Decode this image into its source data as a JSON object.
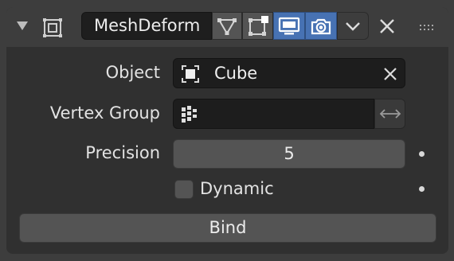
{
  "header": {
    "modifier_name": "MeshDeform",
    "buttons": [
      {
        "icon": "edit-cage-icon",
        "active": false
      },
      {
        "icon": "edit-mode-icon",
        "active": false
      },
      {
        "icon": "realtime-display-icon",
        "active": true
      },
      {
        "icon": "render-camera-icon",
        "active": true
      },
      {
        "icon": "chevron-down-icon",
        "active": false
      }
    ]
  },
  "fields": {
    "object_label": "Object",
    "object_value": "Cube",
    "vertex_group_label": "Vertex Group",
    "vertex_group_value": "",
    "precision_label": "Precision",
    "precision_value": "5",
    "dynamic_label": "Dynamic",
    "dynamic_checked": false
  },
  "actions": {
    "bind_label": "Bind"
  },
  "colors": {
    "active_button": "#4772b3",
    "panel": "#303030",
    "header": "#3d3d3d"
  }
}
